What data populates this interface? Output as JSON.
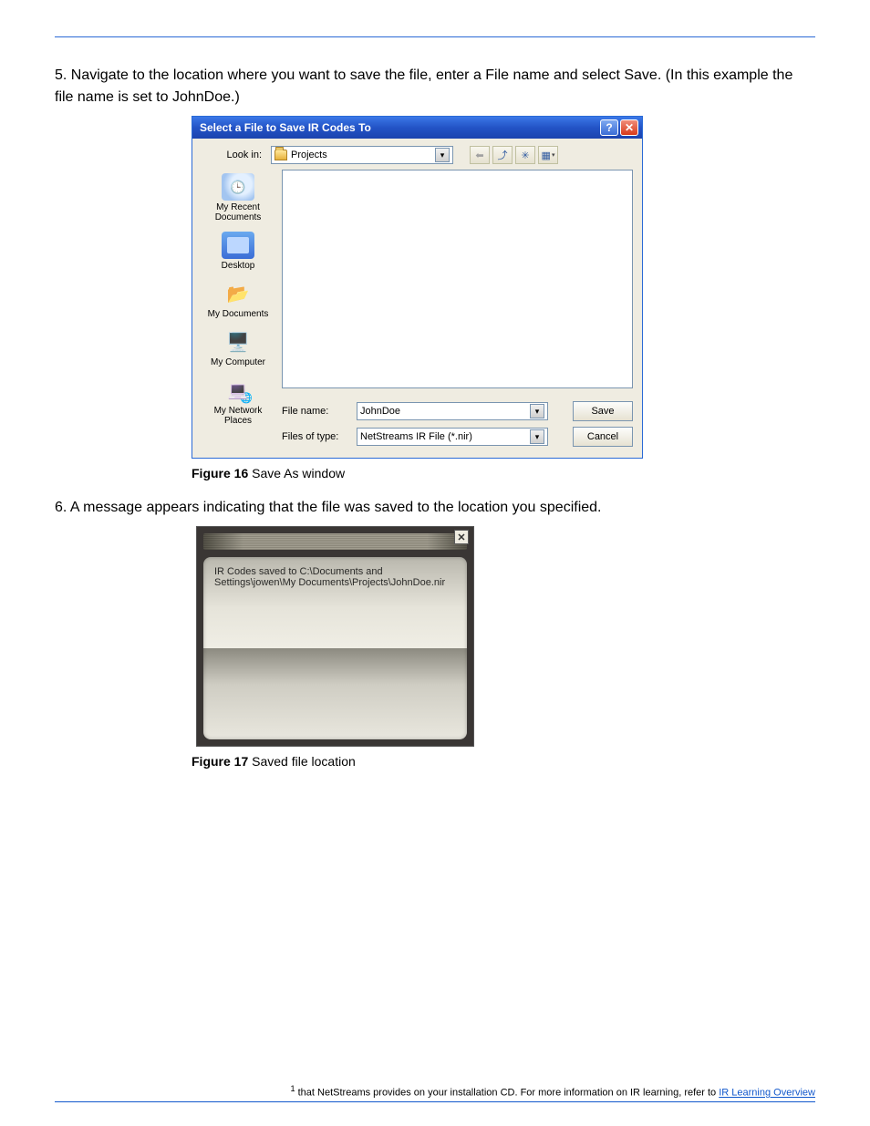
{
  "page": {
    "step5": "5. Navigate to the location where you want to save the file, enter a File name and select Save. (In this example the file name is set to JohnDoe.)",
    "step6": "6. A message appears indicating that the file was saved to the location you specified.",
    "footnote_label": "1",
    "footnote_body": "that NetStreams provides on your installation CD. For more information on IR learning, refer to ",
    "footnote_link_text": "IR Learning Overview"
  },
  "figure16": {
    "caption_num": "Figure 16",
    "caption_text": " Save As window"
  },
  "figure17": {
    "caption_num": "Figure 17",
    "caption_text": " Saved file location"
  },
  "dialog": {
    "title": "Select a File to Save IR Codes To",
    "look_in_label": "Look in:",
    "look_in_value": "Projects",
    "places": {
      "recent": "My Recent Documents",
      "desktop": "Desktop",
      "docs": "My Documents",
      "computer": "My Computer",
      "network": "My Network Places"
    },
    "file_name_label": "File name:",
    "file_name_value": "JohnDoe",
    "file_type_label": "Files of type:",
    "file_type_value": "NetStreams IR File (*.nir)",
    "save": "Save",
    "cancel": "Cancel"
  },
  "notify": {
    "text": "IR Codes saved to C:\\Documents and Settings\\jowen\\My Documents\\Projects\\JohnDoe.nir"
  }
}
